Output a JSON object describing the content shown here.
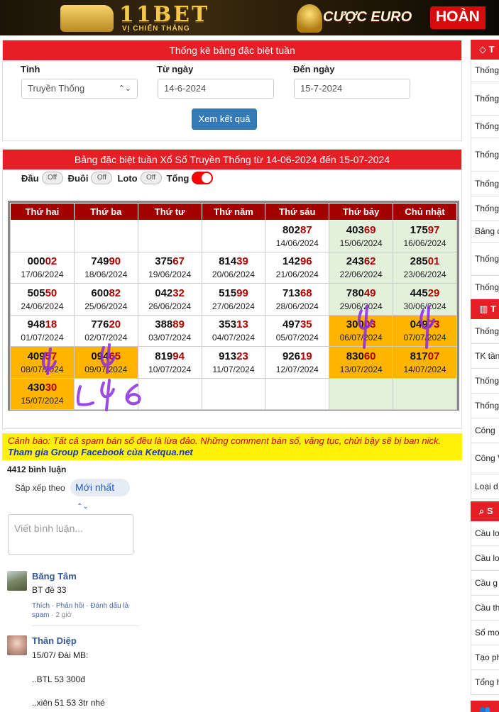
{
  "banner": {
    "brand": "11BET",
    "tagline": "VỊ CHIẾN THẮNG",
    "promo": "CƯỢC EURO",
    "promo_highlight": "HOÀN"
  },
  "search": {
    "title": "Thống kê bảng đặc biệt tuần",
    "province_label": "Tỉnh",
    "province_value": "Truyền Thống",
    "from_label": "Từ ngày",
    "from_value": "14-6-2024",
    "to_label": "Đến ngày",
    "to_value": "15-7-2024",
    "submit_label": "Xem kết quả"
  },
  "table": {
    "title": "Bảng đặc biệt tuần Xổ Số Truyền Thống từ 14-06-2024 đến 15-07-2024",
    "toggles": {
      "dau": "Đầu",
      "duoi": "Đuôi",
      "loto": "Loto",
      "tong": "Tổng",
      "off": "Off"
    },
    "headers": [
      "Thứ hai",
      "Thứ ba",
      "Thứ tư",
      "Thứ năm",
      "Thứ sáu",
      "Thứ bảy",
      "Chủ nhật"
    ],
    "rows": [
      [
        null,
        null,
        null,
        null,
        {
          "h": "802",
          "t": "87",
          "d": "14/06/2024"
        },
        {
          "h": "403",
          "t": "69",
          "d": "15/06/2024"
        },
        {
          "h": "175",
          "t": "97",
          "d": "16/06/2024"
        }
      ],
      [
        {
          "h": "000",
          "t": "02",
          "d": "17/06/2024"
        },
        {
          "h": "749",
          "t": "90",
          "d": "18/06/2024"
        },
        {
          "h": "375",
          "t": "67",
          "d": "19/06/2024"
        },
        {
          "h": "814",
          "t": "39",
          "d": "20/06/2024"
        },
        {
          "h": "142",
          "t": "96",
          "d": "21/06/2024"
        },
        {
          "h": "243",
          "t": "62",
          "d": "22/06/2024"
        },
        {
          "h": "285",
          "t": "01",
          "d": "23/06/2024"
        }
      ],
      [
        {
          "h": "505",
          "t": "50",
          "d": "24/06/2024"
        },
        {
          "h": "600",
          "t": "82",
          "d": "25/06/2024"
        },
        {
          "h": "042",
          "t": "32",
          "d": "26/06/2024"
        },
        {
          "h": "515",
          "t": "99",
          "d": "27/06/2024"
        },
        {
          "h": "713",
          "t": "68",
          "d": "28/06/2024"
        },
        {
          "h": "780",
          "t": "49",
          "d": "29/06/2024"
        },
        {
          "h": "445",
          "t": "29",
          "d": "30/06/2024"
        }
      ],
      [
        {
          "h": "948",
          "t": "18",
          "d": "01/07/2024"
        },
        {
          "h": "776",
          "t": "20",
          "d": "02/07/2024"
        },
        {
          "h": "388",
          "t": "89",
          "d": "03/07/2024"
        },
        {
          "h": "353",
          "t": "13",
          "d": "04/07/2024"
        },
        {
          "h": "497",
          "t": "35",
          "d": "05/07/2024"
        },
        {
          "h": "300",
          "t": "03",
          "d": "06/07/2024",
          "hot": true
        },
        {
          "h": "049",
          "t": "73",
          "d": "07/07/2024",
          "hot": true
        }
      ],
      [
        {
          "h": "409",
          "t": "57",
          "d": "08/07/2024",
          "hot": true
        },
        {
          "h": "094",
          "t": "65",
          "d": "09/07/2024",
          "hot": true
        },
        {
          "h": "819",
          "t": "94",
          "d": "10/07/2024"
        },
        {
          "h": "913",
          "t": "23",
          "d": "11/07/2024"
        },
        {
          "h": "926",
          "t": "19",
          "d": "12/07/2024"
        },
        {
          "h": "830",
          "t": "60",
          "d": "13/07/2024",
          "hot": true
        },
        {
          "h": "817",
          "t": "07",
          "d": "14/07/2024",
          "hot": true
        }
      ],
      [
        {
          "h": "430",
          "t": "30",
          "d": "15/07/2024",
          "hot": true
        },
        null,
        null,
        null,
        null,
        null,
        null
      ]
    ]
  },
  "warning": {
    "label": "Cảnh báo",
    "text": ": Tất cả spam bán số đều là lừa đảo. Những comment bán số, văng tục, chửi bậy sẽ bị ban nick.",
    "link": "Tham gia Group Facebook của Ketqua.net"
  },
  "comments": {
    "count": "4412 bình luận",
    "sort_label": "Sắp xếp theo",
    "sort_value": "Mới nhất",
    "placeholder": "Viết bình luận...",
    "items": [
      {
        "author": "Băng Tâm",
        "lines": [
          "BT đề 33"
        ],
        "like": "Thích",
        "reply": "Phản hồi",
        "spam": "Đánh dấu là spam",
        "time": "2 giờ"
      },
      {
        "author": "Thân Diệp",
        "lines": [
          "15/07/ Đài MB:",
          "..BTL 53 300đ",
          "..xiên 51 53 3tr nhé"
        ]
      }
    ]
  },
  "sidebar": {
    "section1": "T",
    "items1": [
      "Thống",
      "Thống loto",
      "Thống",
      "Thống loto",
      "Thống",
      "Thống",
      "Bảng đ",
      "Thống theo Đ",
      "Thống"
    ],
    "section2": "T",
    "items2": [
      "Thống",
      "TK tần",
      "Thống",
      "Thống",
      "Công",
      "Công VIP",
      "Loại d"
    ],
    "section3": "S",
    "items3": [
      "Cầu lo",
      "Cầu lo",
      "Cầu g",
      "Cầu th",
      "Số mơ",
      "Tạo ph",
      "Tổng h"
    ]
  },
  "colors": {
    "header_red": "#e61e25",
    "table_header": "#a50000",
    "weekend_green": "#e2f0dc",
    "highlight_orange": "#ffb400",
    "button_blue": "#337ab7",
    "warning_yellow": "#fff10a"
  }
}
